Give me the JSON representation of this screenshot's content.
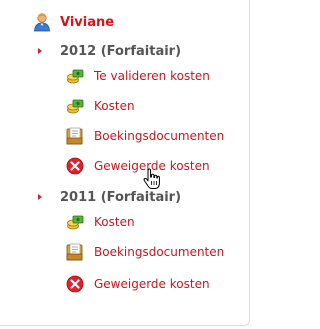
{
  "user": {
    "name": "Viviane"
  },
  "tree": [
    {
      "year_label": "2012 (Forfaitair)",
      "items": [
        {
          "label": "Te valideren kosten",
          "icon": "coins-icon"
        },
        {
          "label": "Kosten",
          "icon": "coins-icon"
        },
        {
          "label": "Boekingsdocumenten",
          "icon": "document-folder-icon"
        },
        {
          "label": "Geweigerde kosten",
          "icon": "red-x-icon"
        }
      ]
    },
    {
      "year_label": "2011 (Forfaitair)",
      "items": [
        {
          "label": "Kosten",
          "icon": "coins-icon"
        },
        {
          "label": "Boekingsdocumenten",
          "icon": "document-folder-icon"
        },
        {
          "label": "Geweigerde kosten",
          "icon": "red-x-icon"
        }
      ]
    }
  ],
  "colors": {
    "accent": "#c8161d",
    "year_text": "#555555"
  }
}
